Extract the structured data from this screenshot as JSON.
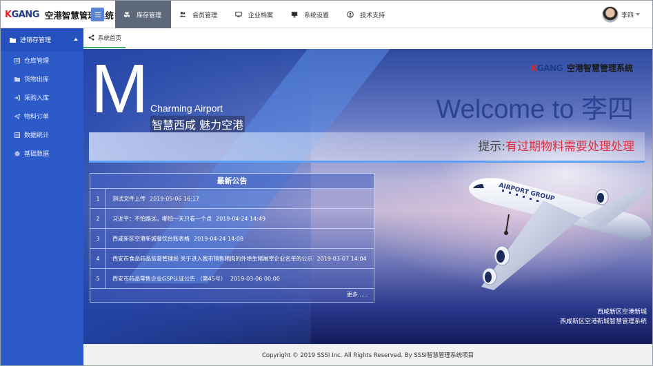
{
  "app": {
    "logo_mark_k": "K",
    "logo_mark_gang": "GANG",
    "title": "空港智慧管理系统"
  },
  "nav": {
    "items": [
      {
        "label": "库存管理",
        "icon": "cubes-icon",
        "active": true
      },
      {
        "label": "会员管理",
        "icon": "users-icon"
      },
      {
        "label": "企业档案",
        "icon": "monitor-icon"
      },
      {
        "label": "系统设置",
        "icon": "desktop-icon"
      },
      {
        "label": "技术支持",
        "icon": "user-circle-icon"
      }
    ]
  },
  "user": {
    "name": "李四"
  },
  "sidebar": {
    "group": {
      "label": "进销存管理",
      "icon": "folder-icon"
    },
    "items": [
      {
        "label": "仓库管理",
        "icon": "list-icon"
      },
      {
        "label": "货物出库",
        "icon": "folder-icon"
      },
      {
        "label": "采购入库",
        "icon": "sign-in-icon"
      },
      {
        "label": "物料订单",
        "icon": "send-icon"
      },
      {
        "label": "数据统计",
        "icon": "table-icon"
      },
      {
        "label": "基础数据",
        "icon": "gear-icon"
      }
    ]
  },
  "tabs": {
    "home": {
      "label": "系统首页",
      "icon": "share-icon"
    }
  },
  "banner": {
    "big_letter": "M",
    "subtitle_en": "Charming Airport",
    "slogan": "智慧西咸 魅力空港",
    "logo_text": "空港智慧管理系统",
    "welcome": "Welcome to 李四",
    "hint_label": "提示:",
    "hint_text": "有过期物料需要处理处理",
    "plane_label": "AIRPORT GROUP",
    "footnote_line1": "西咸新区空港新城",
    "footnote_line2": "西咸新区空港新城智慧管理系统"
  },
  "notice": {
    "title": "最新公告",
    "more": "更多......",
    "rows": [
      {
        "num": "1",
        "text": "测试文件上传",
        "date": "2019-05-06 16:17"
      },
      {
        "num": "2",
        "text": "习近平：不怕路远，哪怕一天只看一个点",
        "date": "2019-04-24 14:49"
      },
      {
        "num": "3",
        "text": "西咸新区空港新城餐饮台账表格",
        "date": "2019-04-24 14:08"
      },
      {
        "num": "4",
        "text": "西安市食品药品监督管理局 关于进入我市销售猪肉的外埠生猪屠宰企业名单的公示",
        "date": "2019-03-07 14:04"
      },
      {
        "num": "5",
        "text": "西安市药品零售企业GSP认证公告 （第45号）",
        "date": "2019-03-06 00:00"
      }
    ]
  },
  "footer": {
    "copyright": "Copyright © 2019 SSSI Inc. All Rights Reserved. By SSSI智慧管理系统项目"
  },
  "colors": {
    "sidebar": "#2c5ac8",
    "nav_active": "#5d6878",
    "tab_active": "#3ab06e",
    "hint_red": "#e0303d",
    "welcome_blue": "#2b4393"
  }
}
